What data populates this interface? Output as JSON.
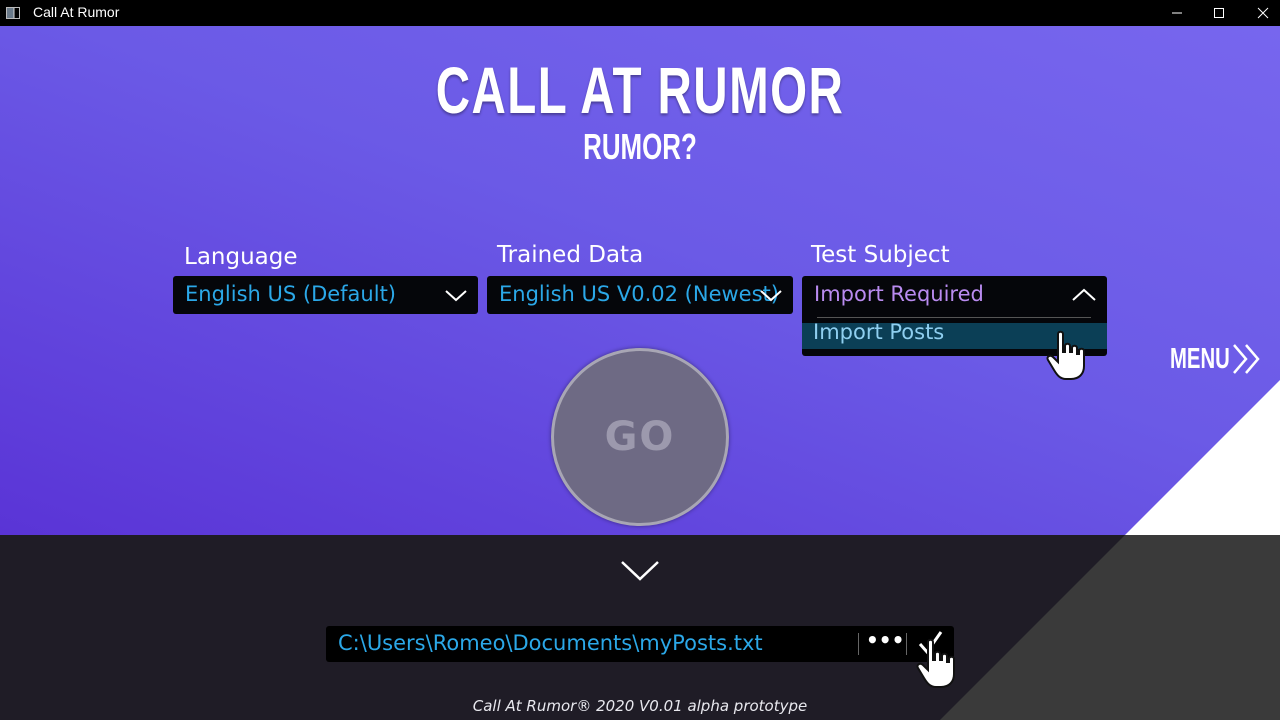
{
  "window": {
    "title": "Call At Rumor"
  },
  "header": {
    "title": "CALL AT RUMOR",
    "subtitle": "RUMOR?"
  },
  "language": {
    "label": "Language",
    "value": "English US (Default)"
  },
  "trained_data": {
    "label": "Trained Data",
    "value": "English US V0.02 (Newest)"
  },
  "test_subject": {
    "label": "Test Subject",
    "value": "Import Required",
    "options": [
      "Import Posts"
    ]
  },
  "menu": {
    "label": "MENU"
  },
  "go": {
    "label": "GO"
  },
  "file": {
    "path": "C:\\Users\\Romeo\\Documents\\myPosts.txt",
    "browse_label": "•••"
  },
  "footer": {
    "text": "Call At Rumor® 2020 V0.01 alpha prototype"
  },
  "colors": {
    "accent": "#2ba8e8",
    "placeholder": "#b98bf0",
    "bg_top": "#7766ee",
    "bg_bottom": "#5a34d6",
    "panel": "#1f1c26"
  }
}
